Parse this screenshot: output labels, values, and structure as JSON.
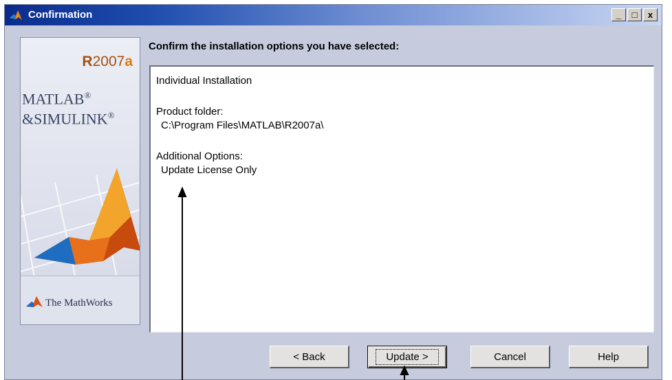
{
  "window": {
    "title": "Confirmation",
    "controls": {
      "minimize": "_",
      "maximize": "□",
      "close": "x"
    }
  },
  "side_panel": {
    "release": {
      "r": "R",
      "number": "2007",
      "letter": "a"
    },
    "brand_line1": "MATLAB",
    "brand_line2": "&SIMULINK",
    "registered": "®",
    "company": "The MathWorks"
  },
  "main": {
    "heading": "Confirm the installation options you have selected:",
    "summary": {
      "install_type": "Individual Installation",
      "folder_label": "Product folder:",
      "folder_value": "C:\\Program Files\\MATLAB\\R2007a\\",
      "options_label": "Additional Options:",
      "options_value": "Update License Only"
    }
  },
  "buttons": {
    "back": "< Back",
    "update": "Update >",
    "cancel": "Cancel",
    "help": "Help"
  },
  "colors": {
    "window_bg": "#c6cbde",
    "titlebar_start": "#0a2b8c",
    "titlebar_end": "#c9d6f2",
    "release_orange": "#e07a10"
  },
  "icons": [
    "matlab-logo-icon",
    "minimize-icon",
    "maximize-icon",
    "close-icon",
    "mathworks-logo-icon"
  ]
}
